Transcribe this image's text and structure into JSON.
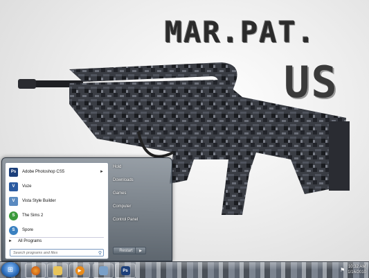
{
  "wallpaper": {
    "title": "MAR.PAT.",
    "subtitle": "US"
  },
  "start_menu": {
    "programs": [
      {
        "label": "Adobe Photoshop CS5",
        "icon": "photoshop-icon",
        "icon_text": "Ps",
        "color": "#1c3f7a",
        "has_arrow": true
      },
      {
        "label": "Vuze",
        "icon": "vuze-icon",
        "icon_text": "V",
        "color": "#2a5aa0"
      },
      {
        "label": "Vista Style Builder",
        "icon": "vista-style-builder-icon",
        "icon_text": "V",
        "color": "#5a8ac0"
      },
      {
        "label": "The Sims 2",
        "icon": "sims-icon",
        "icon_text": "S",
        "color": "#3a9a3a"
      },
      {
        "label": "Spore",
        "icon": "spore-icon",
        "icon_text": "S",
        "color": "#3a80c0"
      }
    ],
    "arrow": "►",
    "all_programs": "All Programs",
    "search_placeholder": "Search programs and files",
    "right_links": [
      "Hold",
      "Downloads",
      "Games",
      "Computer",
      "Control Panel"
    ],
    "shutdown_label": "Restart",
    "shutdown_arrow": "▶"
  },
  "taskbar": {
    "start_glyph": "⊞",
    "pinned": [
      {
        "name": "firefox-icon",
        "text": "",
        "color": "#e06a1a"
      },
      {
        "name": "explorer-folder-icon",
        "text": "",
        "color": "#e8c45a"
      },
      {
        "name": "media-player-icon",
        "text": "▶",
        "color": "#e88a1a"
      },
      {
        "name": "network-icon",
        "text": "",
        "color": "#7aa0c8"
      },
      {
        "name": "photoshop-taskbar-icon",
        "text": "Ps",
        "color": "#1c3f7a"
      }
    ],
    "clock_time": "10:32 AM",
    "clock_date": "1/16/2010"
  }
}
